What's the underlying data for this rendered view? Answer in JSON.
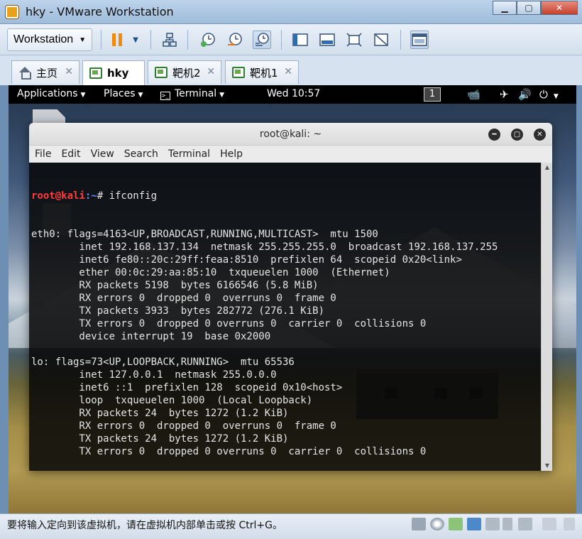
{
  "vmware": {
    "title": "hky - VMware Workstation",
    "menu_label": "Workstation",
    "tabs": [
      {
        "label": "主页"
      },
      {
        "label": "hky"
      },
      {
        "label": "靶机2"
      },
      {
        "label": "靶机1"
      }
    ],
    "status_text": "要将输入定向到该虚拟机，请在虚拟机内部单击或按 Ctrl+G。"
  },
  "kali": {
    "applications": "Applications",
    "places": "Places",
    "terminal_app": "Terminal",
    "clock": "Wed 10:57",
    "workspace": "1"
  },
  "terminal": {
    "title": "root@kali: ~",
    "menu": [
      "File",
      "Edit",
      "View",
      "Search",
      "Terminal",
      "Help"
    ],
    "prompt_user": "root@kali",
    "prompt_path": ":~",
    "prompt_symbol": "# ",
    "command": "ifconfig",
    "output": [
      "eth0: flags=4163<UP,BROADCAST,RUNNING,MULTICAST>  mtu 1500",
      "        inet 192.168.137.134  netmask 255.255.255.0  broadcast 192.168.137.255",
      "        inet6 fe80::20c:29ff:feaa:8510  prefixlen 64  scopeid 0x20<link>",
      "        ether 00:0c:29:aa:85:10  txqueuelen 1000  (Ethernet)",
      "        RX packets 5198  bytes 6166546 (5.8 MiB)",
      "        RX errors 0  dropped 0  overruns 0  frame 0",
      "        TX packets 3933  bytes 282772 (276.1 KiB)",
      "        TX errors 0  dropped 0 overruns 0  carrier 0  collisions 0",
      "        device interrupt 19  base 0x2000",
      "",
      "lo: flags=73<UP,LOOPBACK,RUNNING>  mtu 65536",
      "        inet 127.0.0.1  netmask 255.0.0.0",
      "        inet6 ::1  prefixlen 128  scopeid 0x10<host>",
      "        loop  txqueuelen 1000  (Local Loopback)",
      "        RX packets 24  bytes 1272 (1.2 KiB)",
      "        RX errors 0  dropped 0  overruns 0  frame 0",
      "        TX packets 24  bytes 1272 (1.2 KiB)",
      "        TX errors 0  dropped 0 overruns 0  carrier 0  collisions 0",
      ""
    ]
  }
}
